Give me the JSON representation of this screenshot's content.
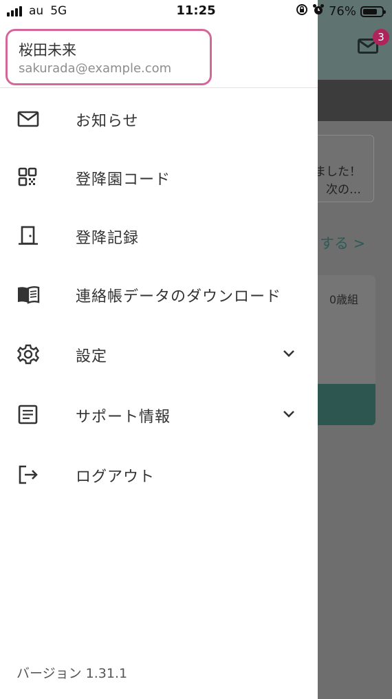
{
  "status_bar": {
    "carrier": "au",
    "network": "5G",
    "time": "11:25",
    "battery": "76%",
    "battery_level": 0.76
  },
  "background": {
    "mail_badge": "3",
    "card_line1": "ました！",
    "card_line2": "次の…",
    "link_text": "する >",
    "age_text": "0歳組"
  },
  "drawer": {
    "profile": {
      "name": "桜田未来",
      "email": "sakurada@example.com"
    },
    "items": [
      {
        "label": "お知らせ",
        "icon": "mail-icon"
      },
      {
        "label": "登降園コード",
        "icon": "qr-code-icon"
      },
      {
        "label": "登降記録",
        "icon": "door-icon"
      },
      {
        "label": "連絡帳データのダウンロード",
        "icon": "book-icon"
      },
      {
        "label": "設定",
        "icon": "gear-icon"
      },
      {
        "label": "サポート情報",
        "icon": "document-icon"
      },
      {
        "label": "ログアウト",
        "icon": "logout-icon"
      }
    ],
    "version": "バージョン 1.31.1"
  },
  "colors": {
    "profile_border": "#d4679a",
    "badge": "#b0245c",
    "accent": "#2d5651"
  }
}
